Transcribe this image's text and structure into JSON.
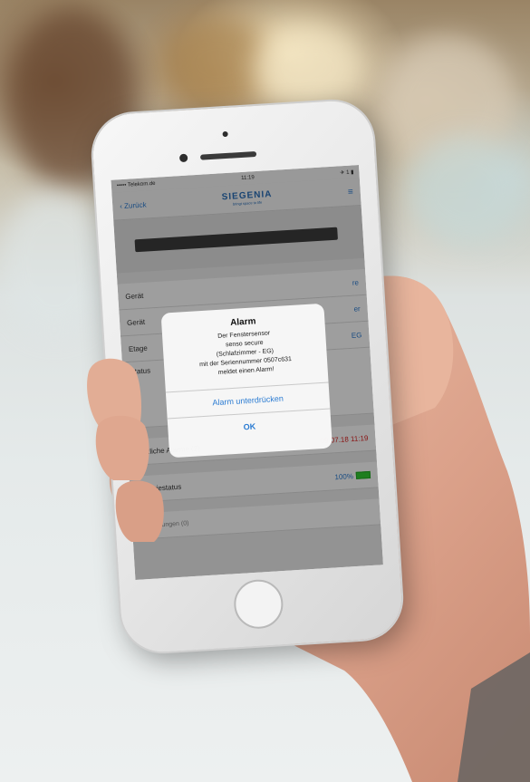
{
  "screen": {
    "status": {
      "carrier": "••••• Telekom.de",
      "time": "11:19",
      "right": "✈ 1 ▮"
    },
    "nav": {
      "back_label": "Zurück",
      "logo": "SIEGENIA",
      "tagline": "bringt space to life",
      "menu_icon": "menu-icon"
    },
    "rows": [
      {
        "label": "Gerät",
        "value": "re"
      },
      {
        "label": "Gerät",
        "value": "er"
      },
      {
        "label": "Etage",
        "value": "EG"
      },
      {
        "label": "Status",
        "value": ""
      }
    ],
    "alarms": {
      "label": "Kürzliche Alarme (2)",
      "value": "09.07.18 11:19"
    },
    "battery": {
      "label": "Batteriestatus",
      "value": "100%"
    },
    "warnings": {
      "label": "Warnungen (0)"
    }
  },
  "dialog": {
    "title": "Alarm",
    "message_lines": [
      "Der Fenstersensor",
      "senso secure",
      "(Schlafzimmer - EG)",
      "mit der Seriennummer 0507c631",
      "meldet einen Alarm!"
    ],
    "suppress_label": "Alarm unterdrücken",
    "ok_label": "OK"
  }
}
